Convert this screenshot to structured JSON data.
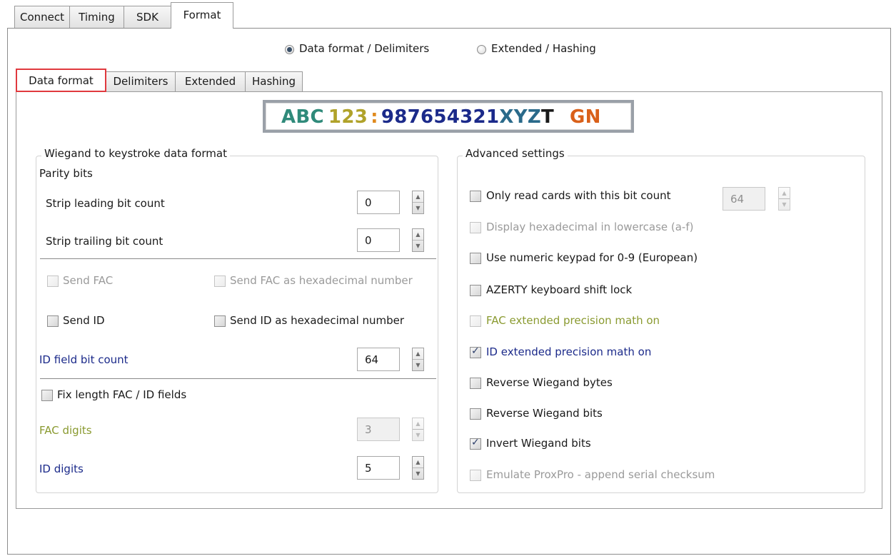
{
  "main_tabs": [
    {
      "label": "Connect",
      "active": false
    },
    {
      "label": "Timing",
      "active": false
    },
    {
      "label": "SDK",
      "active": false
    },
    {
      "label": "Format",
      "active": true
    }
  ],
  "mode_radios": [
    {
      "label": "Data format / Delimiters",
      "selected": true
    },
    {
      "label": "Extended / Hashing",
      "selected": false
    }
  ],
  "sub_tabs": [
    {
      "label": "Data format",
      "active": true
    },
    {
      "label": "Delimiters",
      "active": false
    },
    {
      "label": "Extended",
      "active": false
    },
    {
      "label": "Hashing",
      "active": false
    }
  ],
  "preview": {
    "segments": [
      {
        "text": "ABC",
        "color": "#2f8a7a"
      },
      {
        "text": "123",
        "color": "#b0a22a"
      },
      {
        "text": ":",
        "color": "#e08a1e"
      },
      {
        "text": "987654321",
        "color": "#1b2a8a"
      },
      {
        "text": "XYZ",
        "color": "#2a6a8a"
      },
      {
        "text": "T",
        "color": "#1a1a1a"
      },
      {
        "text": "GN",
        "color": "#d9601a"
      }
    ]
  },
  "wiegand": {
    "title": "Wiegand to keystroke data format",
    "parity_label": "Parity bits",
    "strip_leading_label": "Strip leading bit count",
    "strip_leading_value": "0",
    "strip_trailing_label": "Strip trailing bit count",
    "strip_trailing_value": "0",
    "send_fac": {
      "label": "Send FAC",
      "checked": false,
      "enabled": false
    },
    "send_fac_hex": {
      "label": "Send FAC as hexadecimal number",
      "checked": false,
      "enabled": false
    },
    "send_id": {
      "label": "Send ID",
      "checked": false,
      "enabled": true
    },
    "send_id_hex": {
      "label": "Send ID as hexadecimal number",
      "checked": false,
      "enabled": true
    },
    "id_bit_count_label": "ID field bit count",
    "id_bit_count_value": "64",
    "fix_length": {
      "label": "Fix length FAC / ID fields",
      "checked": false,
      "enabled": true
    },
    "fac_digits_label": "FAC digits",
    "fac_digits_value": "3",
    "id_digits_label": "ID digits",
    "id_digits_value": "5"
  },
  "advanced": {
    "title": "Advanced settings",
    "bit_count_value": "64",
    "options": [
      {
        "label": "Only read cards with this bit count",
        "checked": false,
        "enabled": true,
        "color": "#1a1a1a"
      },
      {
        "label": "Display hexadecimal in lowercase (a-f)",
        "checked": false,
        "enabled": false,
        "color": "#9a9a9a"
      },
      {
        "label": "Use numeric keypad for 0-9 (European)",
        "checked": false,
        "enabled": true,
        "color": "#1a1a1a"
      },
      {
        "label": "AZERTY keyboard shift lock",
        "checked": false,
        "enabled": true,
        "color": "#1a1a1a"
      },
      {
        "label": "FAC extended precision math on",
        "checked": false,
        "enabled": false,
        "color": "#8a9a30"
      },
      {
        "label": "ID extended precision math on",
        "checked": true,
        "enabled": true,
        "color": "#1b2a8a"
      },
      {
        "label": "Reverse Wiegand bytes",
        "checked": false,
        "enabled": true,
        "color": "#1a1a1a"
      },
      {
        "label": "Reverse Wiegand bits",
        "checked": false,
        "enabled": true,
        "color": "#1a1a1a"
      },
      {
        "label": "Invert Wiegand bits",
        "checked": true,
        "enabled": true,
        "color": "#1a1a1a"
      },
      {
        "label": "Emulate ProxPro - append serial checksum",
        "checked": false,
        "enabled": false,
        "color": "#9a9a9a"
      }
    ]
  }
}
